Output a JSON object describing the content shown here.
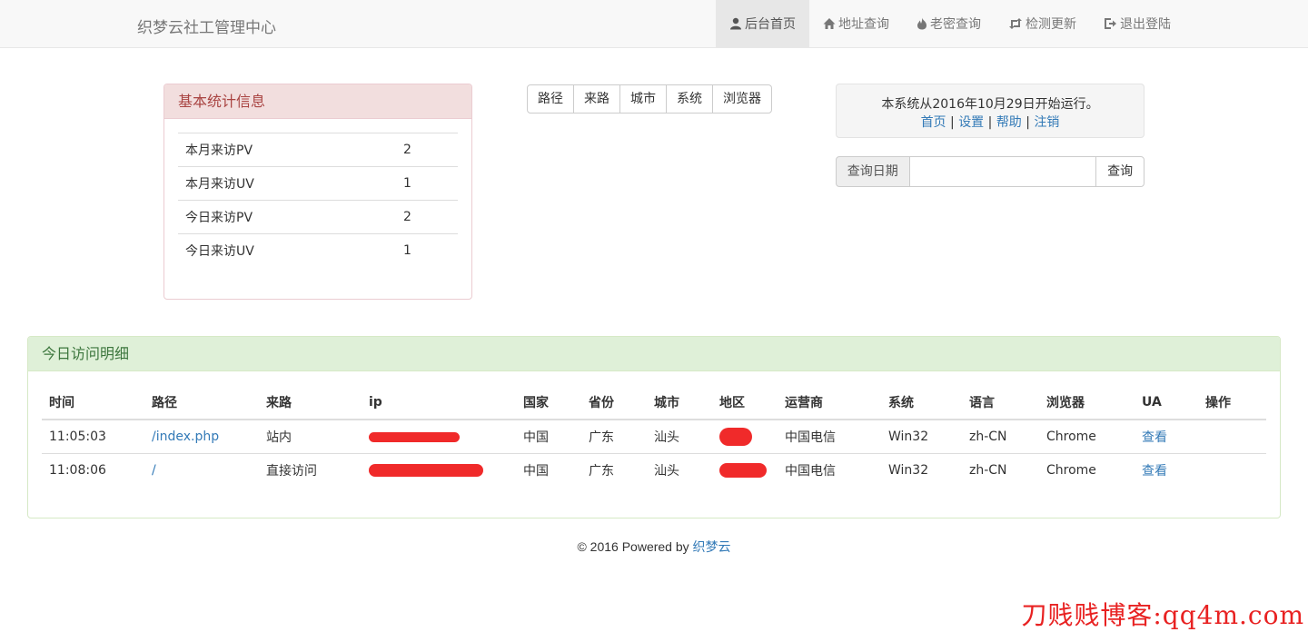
{
  "brand": "织梦云社工管理中心",
  "nav": [
    {
      "label": "后台首页",
      "icon": "user-icon",
      "active": true
    },
    {
      "label": "地址查询",
      "icon": "home-icon",
      "active": false
    },
    {
      "label": "老密查询",
      "icon": "fire-icon",
      "active": false
    },
    {
      "label": "检测更新",
      "icon": "retweet-icon",
      "active": false
    },
    {
      "label": "退出登陆",
      "icon": "logout-icon",
      "active": false
    }
  ],
  "stats": {
    "title": "基本统计信息",
    "rows": [
      {
        "label": "本月来访PV",
        "value": "2"
      },
      {
        "label": "本月来访UV",
        "value": "1"
      },
      {
        "label": "今日来访PV",
        "value": "2"
      },
      {
        "label": "今日来访UV",
        "value": "1"
      }
    ]
  },
  "filters": [
    "路径",
    "来路",
    "城市",
    "系统",
    "浏览器"
  ],
  "info": {
    "text": "本系统从2016年10月29日开始运行。",
    "links": [
      "首页",
      "设置",
      "帮助",
      "注销"
    ],
    "separator": "|"
  },
  "query": {
    "label": "查询日期",
    "value": "",
    "button": "查询"
  },
  "detail": {
    "title": "今日访问明细",
    "headers": [
      "时间",
      "路径",
      "来路",
      "ip",
      "国家",
      "省份",
      "城市",
      "地区",
      "运营商",
      "系统",
      "语言",
      "浏览器",
      "UA",
      "操作"
    ],
    "rows": [
      {
        "time": "11:05:03",
        "path": "/index.php",
        "referrer": "站内",
        "country": "中国",
        "province": "广东",
        "city": "汕头",
        "isp": "中国电信",
        "os": "Win32",
        "lang": "zh-CN",
        "browser": "Chrome",
        "ua": "查看",
        "op": ""
      },
      {
        "time": "11:08:06",
        "path": "/",
        "referrer": "直接访问",
        "country": "中国",
        "province": "广东",
        "city": "汕头",
        "isp": "中国电信",
        "os": "Win32",
        "lang": "zh-CN",
        "browser": "Chrome",
        "ua": "查看",
        "op": ""
      }
    ]
  },
  "footer": {
    "text": "© 2016 Powered by",
    "link": "织梦云"
  },
  "watermark": "刀贱贱博客:qq4m.com",
  "colors": {
    "stats_heading": "#f2dede",
    "detail_heading": "#dff0d8",
    "link": "#337ab7",
    "redaction": "#f02a2a"
  }
}
